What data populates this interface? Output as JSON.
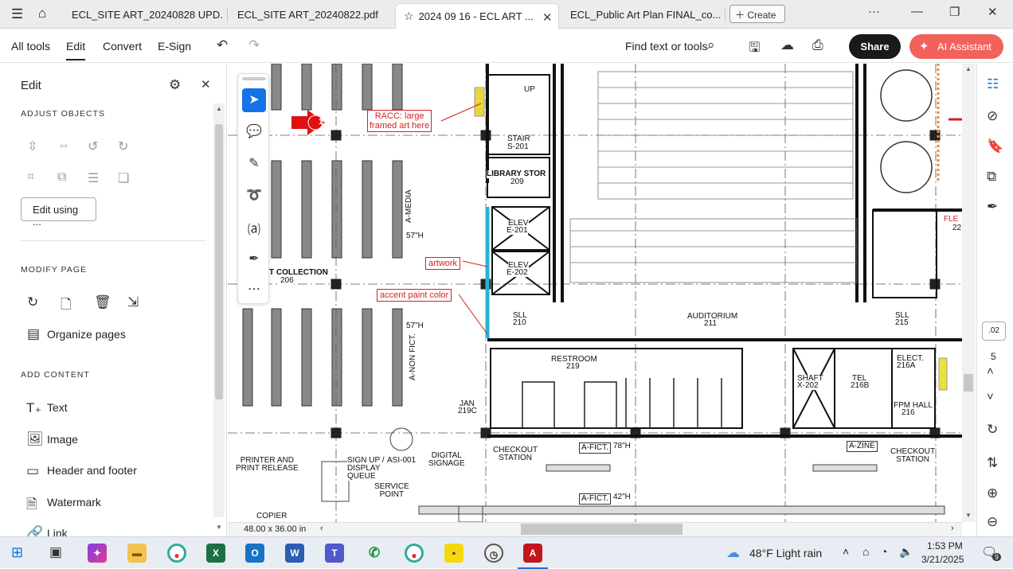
{
  "tabs": [
    {
      "label": "ECL_SITE ART_20240828 UPD..."
    },
    {
      "label": "ECL_SITE ART_20240822.pdf"
    },
    {
      "label": "2024 09 16 - ECL ART ..."
    },
    {
      "label": "ECL_Public Art Plan FINAL_co..."
    }
  ],
  "create_label": "Create",
  "menu": {
    "all_tools": "All tools",
    "edit": "Edit",
    "convert": "Convert",
    "esign": "E-Sign",
    "find": "Find text or tools",
    "share": "Share",
    "ai": "AI Assistant"
  },
  "panel": {
    "title": "Edit",
    "adjust": "ADJUST OBJECTS",
    "edit_using": "Edit using ...",
    "modify": "MODIFY PAGE",
    "organize": "Organize pages",
    "add": "ADD CONTENT",
    "text": "Text",
    "image": "Image",
    "header_footer": "Header and footer",
    "watermark": "Watermark",
    "link": "Link"
  },
  "drawing": {
    "racc": "RACC: large\nframed art here",
    "artwork": "artwork",
    "accent": "accent paint color",
    "stair": "STAIR",
    "stair_no": "S-201",
    "library": "LIBRARY STOR",
    "library_no": "209",
    "elev1": "ELEV",
    "elev1_no": "E-201",
    "elev2": "ELEV",
    "elev2_no": "E-202",
    "collection": "T COLLECTION",
    "collection_no": "206",
    "amedia": "A-MEDIA",
    "h57a": "57\"H",
    "h57b": "57\"H",
    "anonfict": "A-NON FICT.",
    "sll1": "SLL",
    "sll1_no": "210",
    "sll2": "SLL",
    "sll2_no": "215",
    "auditorium": "AUDITORIUM",
    "auditorium_no": "211",
    "restroom": "RESTROOM",
    "restroom_no": "219",
    "shaft": "SHAFT",
    "shaft_no": "X-202",
    "tel": "TEL",
    "tel_no": "216B",
    "elect": "ELECT.",
    "elect_no": "216A",
    "fpm": "FPM HALL",
    "fpm_no": "216",
    "jan": "JAN",
    "jan_no": "219C",
    "afict1": "A-FICT.",
    "h78": "78\"H",
    "afict2": "A-FICT.",
    "h42": "42\"H",
    "azine": "A-ZINE",
    "checkout1": "CHECKOUT\nSTATION",
    "checkout2": "CHECKOUT\nSTATION",
    "digital": "DIGITAL\nSIGNAGE",
    "signup": "SIGN UP /\nDISPLAY\nQUEUE",
    "asi": "ASI-001",
    "service": "SERVICE\nPOINT",
    "printer": "PRINTER AND\nPRINT RELEASE",
    "copier": "COPIER",
    "up": "UP",
    "fle": "FLE",
    "n22": "22",
    "marker": "1"
  },
  "page_size": "48.00 x 36.00 in",
  "page_number": ".02",
  "page_count": "5",
  "weather": "48°F  Light rain",
  "time": "1:53 PM",
  "date": "3/21/2025",
  "notif": "9"
}
